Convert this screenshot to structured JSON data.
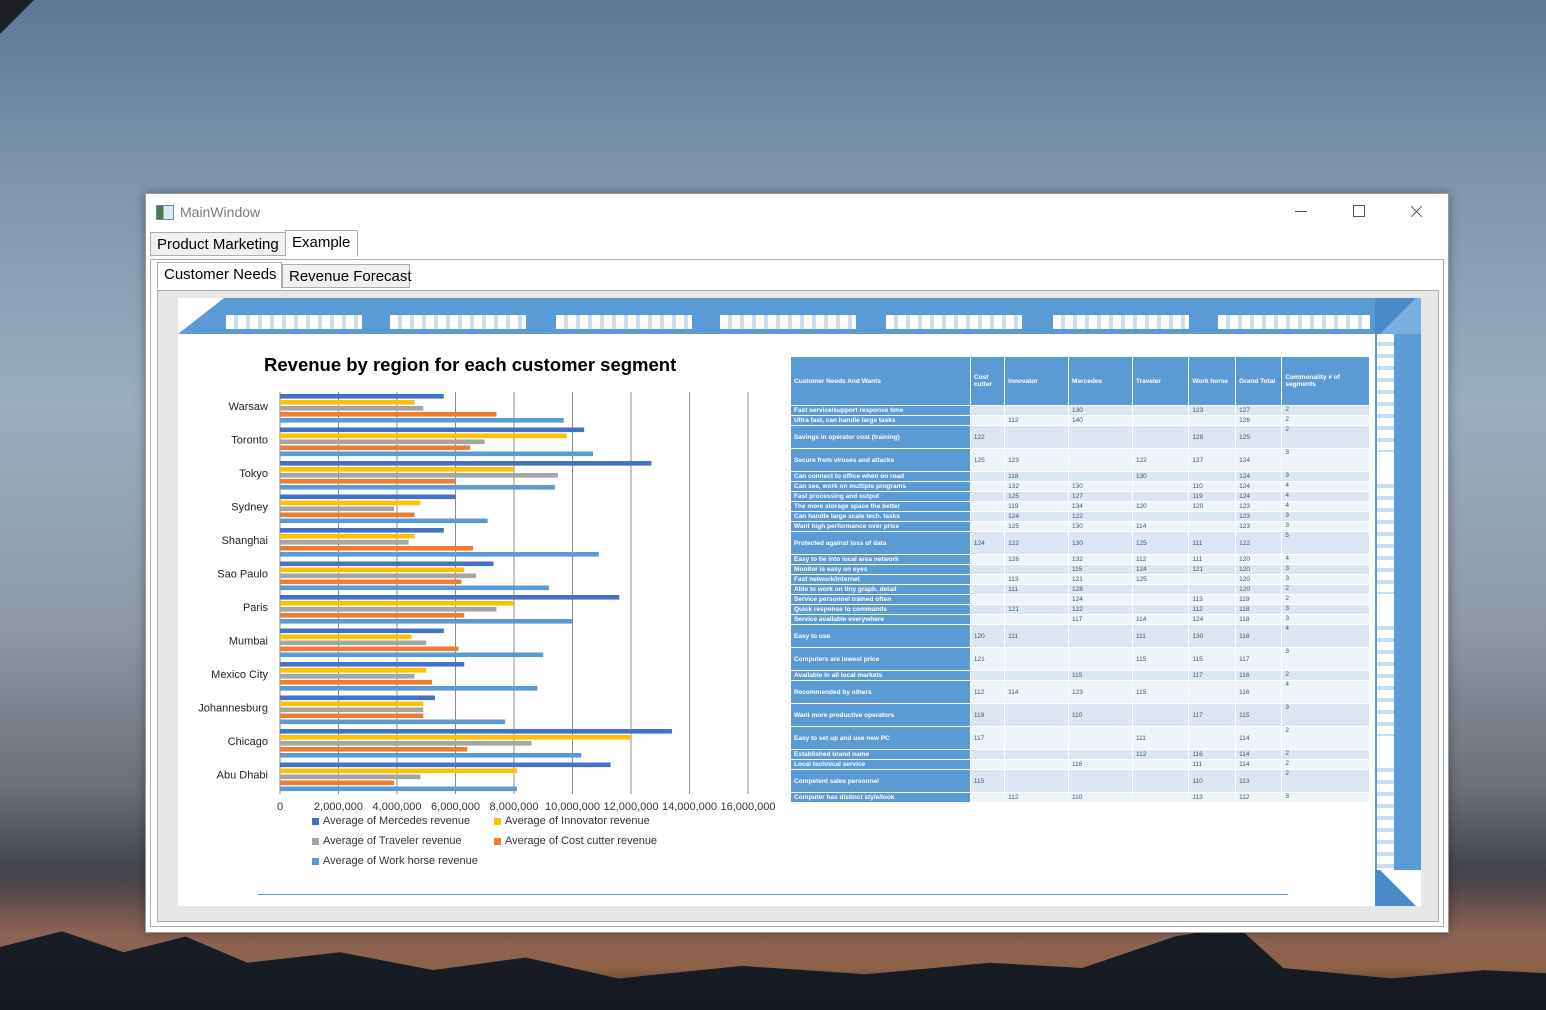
{
  "window": {
    "title": "MainWindow"
  },
  "outer_tabs": [
    "Product Marketing",
    "Example"
  ],
  "inner_tabs": [
    "Customer Needs",
    "Revenue Forecast"
  ],
  "colors": {
    "accent": "#5b9bd5",
    "mercedes": "#4472c4",
    "innovator": "#ffc000",
    "traveler": "#a5a5a5",
    "cost_cutter": "#ed7d31",
    "work_horse": "#5b9bd5"
  },
  "chart_data": {
    "type": "bar",
    "orientation": "horizontal",
    "title": "Revenue by region for each customer segment",
    "categories": [
      "Warsaw",
      "Toronto",
      "Tokyo",
      "Sydney",
      "Shanghai",
      "Sao Paulo",
      "Paris",
      "Mumbai",
      "Mexico City",
      "Johannesburg",
      "Chicago",
      "Abu Dhabi"
    ],
    "series": [
      {
        "name": "Average of Mercedes revenue",
        "values": [
          5600000,
          10400000,
          12700000,
          6000000,
          5600000,
          7300000,
          11600000,
          5600000,
          6300000,
          5300000,
          13400000,
          11300000
        ]
      },
      {
        "name": "Average of Innovator revenue",
        "values": [
          4600000,
          9800000,
          8000000,
          4800000,
          4600000,
          6300000,
          8000000,
          4500000,
          5000000,
          4900000,
          12000000,
          8100000
        ]
      },
      {
        "name": "Average of Traveler revenue",
        "values": [
          4900000,
          7000000,
          9500000,
          3900000,
          4400000,
          6700000,
          7400000,
          5000000,
          4600000,
          4900000,
          8600000,
          4800000
        ]
      },
      {
        "name": "Average of Cost cutter revenue",
        "values": [
          7400000,
          6500000,
          6000000,
          4600000,
          6600000,
          6200000,
          6300000,
          6100000,
          5200000,
          4900000,
          6400000,
          3900000
        ]
      },
      {
        "name": "Average of Work horse revenue",
        "values": [
          9700000,
          10700000,
          9400000,
          7100000,
          10900000,
          9200000,
          10000000,
          9000000,
          8800000,
          7700000,
          10300000,
          8100000
        ]
      }
    ],
    "x_ticks": [
      "0",
      "2,000,000",
      "4,000,000",
      "6,000,000",
      "8,000,000",
      "10,000,000",
      "12,000,000",
      "14,000,000",
      "16,000,000"
    ],
    "xlim": [
      0,
      16000000
    ],
    "grid": "vertical gridlines",
    "legend_position": "bottom"
  },
  "table": {
    "headers": [
      "Customer Needs And Wants",
      "Cost cutter",
      "Innovator",
      "Mercedes",
      "Traveler",
      "Work horse",
      "Grand Total",
      "Commonality # of segments"
    ],
    "rows": [
      [
        "Fast service/support response time",
        "",
        "",
        "130",
        "",
        "123",
        "127",
        "2"
      ],
      [
        "Ultra fast, can handle large tasks",
        "",
        "112",
        "140",
        "",
        "",
        "126",
        "2"
      ],
      [
        "Savings in operator cost (training)",
        "122",
        "",
        "",
        "",
        "128",
        "125",
        "2"
      ],
      [
        "Secure from viruses and attacks",
        "125",
        "123",
        "",
        "122",
        "127",
        "124",
        "3"
      ],
      [
        "Can connect to office when on road",
        "",
        "118",
        "",
        "130",
        "",
        "124",
        "3"
      ],
      [
        "Can see, work on multiple programs",
        "",
        "132",
        "130",
        "",
        "110",
        "124",
        "4"
      ],
      [
        "Fast processing and output",
        "",
        "125",
        "127",
        "",
        "119",
        "124",
        "4"
      ],
      [
        "The more storage space the better",
        "",
        "119",
        "134",
        "120",
        "120",
        "123",
        "4"
      ],
      [
        "Can handle large scale tech. tasks",
        "",
        "124",
        "122",
        "",
        "",
        "123",
        "3"
      ],
      [
        "Want high performance over price",
        "",
        "125",
        "130",
        "114",
        "",
        "123",
        "3"
      ],
      [
        "Protected against loss of data",
        "124",
        "122",
        "130",
        "125",
        "111",
        "122",
        "5"
      ],
      [
        "Easy to tie into local area network",
        "",
        "126",
        "132",
        "112",
        "111",
        "120",
        "4"
      ],
      [
        "Monitor is easy on eyes",
        "",
        "",
        "115",
        "124",
        "121",
        "120",
        "3"
      ],
      [
        "Fast network/internet",
        "",
        "113",
        "121",
        "125",
        "",
        "120",
        "3"
      ],
      [
        "Able to work on tiny graph. detail",
        "",
        "111",
        "128",
        "",
        "",
        "120",
        "2"
      ],
      [
        "Service personnel trained often",
        "",
        "",
        "124",
        "",
        "113",
        "119",
        "2"
      ],
      [
        "Quick response to commands",
        "",
        "121",
        "122",
        "",
        "112",
        "118",
        "3"
      ],
      [
        "Service available everywhere",
        "",
        "",
        "117",
        "114",
        "124",
        "118",
        "3"
      ],
      [
        "Easy to use",
        "120",
        "111",
        "",
        "111",
        "130",
        "118",
        "4"
      ],
      [
        "Computers are lowest price",
        "121",
        "",
        "",
        "115",
        "115",
        "117",
        "3"
      ],
      [
        "Available in all local markets",
        "",
        "",
        "115",
        "",
        "117",
        "116",
        "2"
      ],
      [
        "Recommended by others",
        "112",
        "114",
        "123",
        "115",
        "",
        "116",
        "4"
      ],
      [
        "Want more productive operators",
        "119",
        "",
        "110",
        "",
        "117",
        "115",
        "3"
      ],
      [
        "Easy to set up and use new PC",
        "117",
        "",
        "",
        "111",
        "",
        "114",
        "2"
      ],
      [
        "Established brand name",
        "",
        "",
        "",
        "112",
        "116",
        "114",
        "2"
      ],
      [
        "Local technical service",
        "",
        "",
        "116",
        "",
        "111",
        "114",
        "2"
      ],
      [
        "Competent sales personnel",
        "115",
        "",
        "",
        "",
        "110",
        "113",
        "2"
      ],
      [
        "Computer has distinct style/look",
        "",
        "112",
        "110",
        "",
        "113",
        "112",
        "3"
      ]
    ]
  }
}
